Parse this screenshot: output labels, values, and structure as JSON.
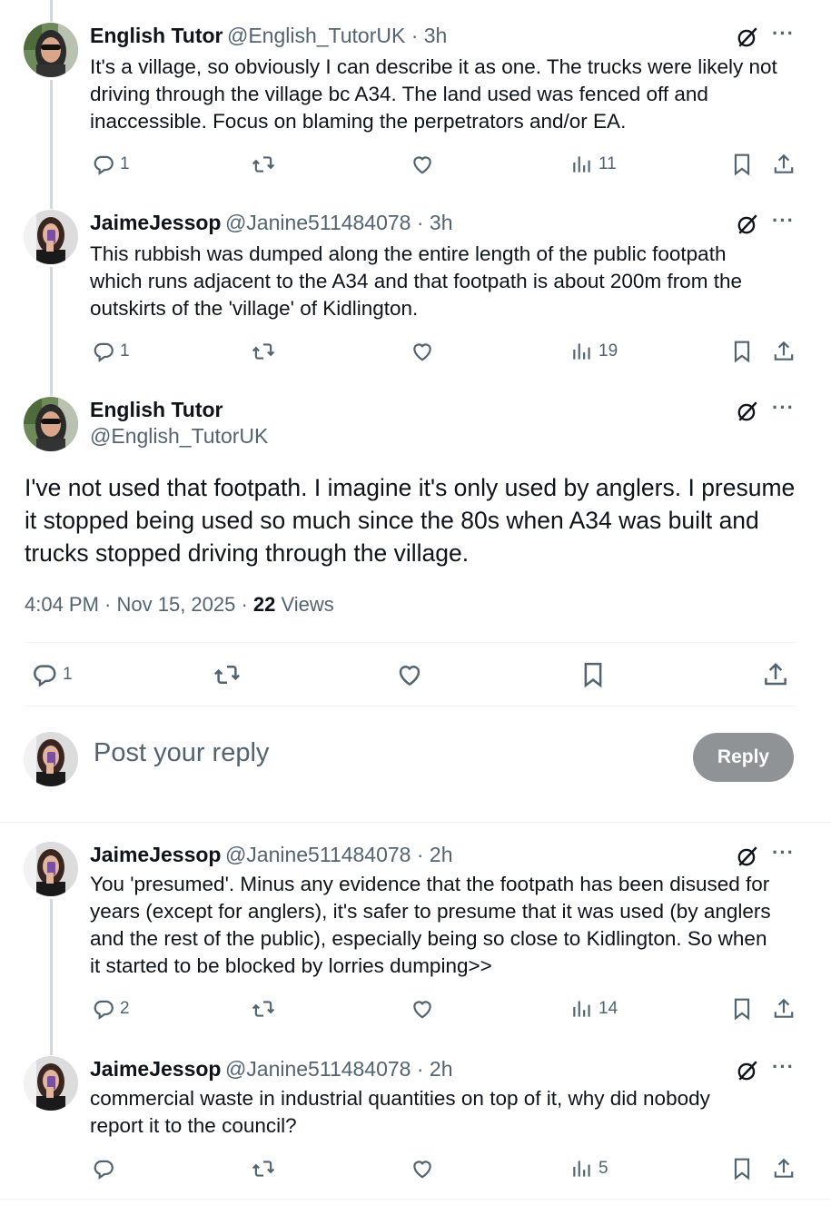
{
  "tweets": [
    {
      "name": "English Tutor",
      "handle": "@English_TutorUK · 3h",
      "lines": [
        "It's a village, so obviously I can describe it as one. The trucks were likely not",
        "driving through the village bc A34. The land used was fenced off and",
        "inaccessible. Focus on blaming the perpetrators and/or EA."
      ],
      "replies": "1",
      "views": "11",
      "avatar": "english-tutor"
    },
    {
      "name": "JaimeJessop",
      "handle": "@Janine511484078 · 3h",
      "lines": [
        "This rubbish was dumped along the entire length of the public footpath",
        "which runs adjacent to the A34 and that footpath is about 200m from the",
        "outskirts of the 'village' of Kidlington."
      ],
      "replies": "1",
      "views": "19",
      "avatar": "jaime"
    }
  ],
  "main_tweet": {
    "name": "English Tutor",
    "handle": "@English_TutorUK",
    "lines": [
      "I've not used that footpath. I imagine it's only used by anglers. I presume",
      "it stopped being used so much since the 80s when A34 was built and",
      "trucks stopped driving through the village."
    ],
    "time": "4:04 PM · Nov 15, 2025 · ",
    "views_count": "22",
    "views_label": " Views",
    "replies": "1"
  },
  "composer": {
    "placeholder": "Post your reply",
    "button": "Reply"
  },
  "replies": [
    {
      "name": "JaimeJessop",
      "handle": "@Janine511484078 · 2h",
      "lines": [
        "You 'presumed'. Minus any evidence that the footpath has been disused for",
        "years (except for anglers), it's safer to presume that it was used (by anglers",
        "and the rest of the public), especially being so close to Kidlington. So when",
        "it started to be blocked by lorries dumping>>"
      ],
      "replies": "2",
      "views": "14"
    },
    {
      "name": "JaimeJessop",
      "handle": "@Janine511484078 · 2h",
      "lines": [
        "commercial waste in industrial quantities on top of it, why did nobody",
        "report it to the council?"
      ],
      "replies": "",
      "views": "5"
    }
  ],
  "icons": {
    "reply": "comment-icon",
    "retweet": "repost-icon",
    "like": "heart-icon",
    "views": "views-icon",
    "bookmark": "bookmark-icon",
    "share": "share-icon",
    "grok": "grok-icon",
    "more": "more-icon"
  },
  "more_glyph": "···",
  "colors": {
    "text": "#0f1419",
    "secondary": "#536471",
    "line": "#cfd9de",
    "reply_button": "#8f9396"
  }
}
